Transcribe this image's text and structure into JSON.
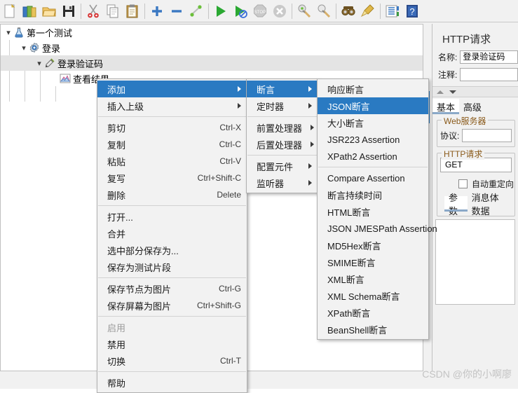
{
  "toolbar": {
    "items": [
      {
        "name": "new-icon",
        "title": "New"
      },
      {
        "name": "templates-icon",
        "title": "Templates"
      },
      {
        "name": "open-icon",
        "title": "Open"
      },
      {
        "name": "save-icon",
        "title": "Save"
      },
      {
        "name": "separator",
        "title": ""
      },
      {
        "name": "cut-icon",
        "title": "Cut"
      },
      {
        "name": "copy-icon",
        "title": "Copy"
      },
      {
        "name": "paste-icon",
        "title": "Paste"
      },
      {
        "name": "separator",
        "title": ""
      },
      {
        "name": "expand-all-icon",
        "title": "Expand All"
      },
      {
        "name": "collapse-all-icon",
        "title": "Collapse All"
      },
      {
        "name": "toggle-icon",
        "title": "Toggle"
      },
      {
        "name": "separator",
        "title": ""
      },
      {
        "name": "start-icon",
        "title": "Start"
      },
      {
        "name": "start-no-timers-icon",
        "title": "Start no pauses"
      },
      {
        "name": "stop-icon",
        "title": "Stop"
      },
      {
        "name": "shutdown-icon",
        "title": "Shutdown"
      },
      {
        "name": "separator",
        "title": ""
      },
      {
        "name": "clear-icon",
        "title": "Clear"
      },
      {
        "name": "clear-all-icon",
        "title": "Clear All"
      },
      {
        "name": "separator",
        "title": ""
      },
      {
        "name": "search-icon",
        "title": "Search"
      },
      {
        "name": "reset-search-icon",
        "title": "Reset Search"
      },
      {
        "name": "separator",
        "title": ""
      },
      {
        "name": "function-helper-icon",
        "title": "Function Helper Dialog"
      },
      {
        "name": "help-icon",
        "title": "Help"
      }
    ]
  },
  "tree": {
    "nodes": [
      {
        "label": "第一个测试",
        "icon": "test-plan-icon",
        "depth": 0,
        "toggle": "expanded",
        "selected": false
      },
      {
        "label": "登录",
        "icon": "thread-group-icon",
        "depth": 1,
        "toggle": "expanded",
        "selected": false
      },
      {
        "label": "登录验证码",
        "icon": "http-sampler-icon",
        "depth": 2,
        "toggle": "expanded",
        "selected": true
      },
      {
        "label": "查看结果",
        "icon": "view-results-icon",
        "depth": 3,
        "toggle": "none",
        "selected": false
      }
    ]
  },
  "context_menu": {
    "items": [
      {
        "label": "添加",
        "accel": "",
        "submenu": true,
        "highlighted": true,
        "disabled": false
      },
      {
        "label": "插入上级",
        "accel": "",
        "submenu": true,
        "highlighted": false,
        "disabled": false
      },
      {
        "separator": true
      },
      {
        "label": "剪切",
        "accel": "Ctrl-X",
        "submenu": false,
        "highlighted": false,
        "disabled": false
      },
      {
        "label": "复制",
        "accel": "Ctrl-C",
        "submenu": false,
        "highlighted": false,
        "disabled": false
      },
      {
        "label": "粘贴",
        "accel": "Ctrl-V",
        "submenu": false,
        "highlighted": false,
        "disabled": false
      },
      {
        "label": "复写",
        "accel": "Ctrl+Shift-C",
        "submenu": false,
        "highlighted": false,
        "disabled": false
      },
      {
        "label": "删除",
        "accel": "Delete",
        "submenu": false,
        "highlighted": false,
        "disabled": false
      },
      {
        "separator": true
      },
      {
        "label": "打开...",
        "accel": "",
        "submenu": false,
        "highlighted": false,
        "disabled": false
      },
      {
        "label": "合并",
        "accel": "",
        "submenu": false,
        "highlighted": false,
        "disabled": false
      },
      {
        "label": "选中部分保存为...",
        "accel": "",
        "submenu": false,
        "highlighted": false,
        "disabled": false
      },
      {
        "label": "保存为测试片段",
        "accel": "",
        "submenu": false,
        "highlighted": false,
        "disabled": false
      },
      {
        "separator": true
      },
      {
        "label": "保存节点为图片",
        "accel": "Ctrl-G",
        "submenu": false,
        "highlighted": false,
        "disabled": false
      },
      {
        "label": "保存屏幕为图片",
        "accel": "Ctrl+Shift-G",
        "submenu": false,
        "highlighted": false,
        "disabled": false
      },
      {
        "separator": true
      },
      {
        "label": "启用",
        "accel": "",
        "submenu": false,
        "highlighted": false,
        "disabled": true
      },
      {
        "label": "禁用",
        "accel": "",
        "submenu": false,
        "highlighted": false,
        "disabled": false
      },
      {
        "label": "切换",
        "accel": "Ctrl-T",
        "submenu": false,
        "highlighted": false,
        "disabled": false
      },
      {
        "separator": true
      },
      {
        "label": "帮助",
        "accel": "",
        "submenu": false,
        "highlighted": false,
        "disabled": false
      }
    ]
  },
  "add_menu": {
    "items": [
      {
        "label": "断言",
        "submenu": true,
        "highlighted": true
      },
      {
        "label": "定时器",
        "submenu": true,
        "highlighted": false
      },
      {
        "separator": true
      },
      {
        "label": "前置处理器",
        "submenu": true,
        "highlighted": false
      },
      {
        "label": "后置处理器",
        "submenu": true,
        "highlighted": false
      },
      {
        "separator": true
      },
      {
        "label": "配置元件",
        "submenu": true,
        "highlighted": false
      },
      {
        "label": "监听器",
        "submenu": true,
        "highlighted": false
      }
    ]
  },
  "assertion_menu": {
    "items": [
      {
        "label": "响应断言",
        "highlighted": false
      },
      {
        "label": "JSON断言",
        "highlighted": true
      },
      {
        "label": "大小断言",
        "highlighted": false
      },
      {
        "label": "JSR223 Assertion",
        "highlighted": false
      },
      {
        "label": "XPath2 Assertion",
        "highlighted": false
      },
      {
        "separator": true
      },
      {
        "label": "Compare Assertion",
        "highlighted": false
      },
      {
        "label": "断言持续时间",
        "highlighted": false
      },
      {
        "label": "HTML断言",
        "highlighted": false
      },
      {
        "label": "JSON JMESPath Assertion",
        "highlighted": false
      },
      {
        "label": "MD5Hex断言",
        "highlighted": false
      },
      {
        "label": "SMIME断言",
        "highlighted": false
      },
      {
        "label": "XML断言",
        "highlighted": false
      },
      {
        "label": "XML Schema断言",
        "highlighted": false
      },
      {
        "label": "XPath断言",
        "highlighted": false
      },
      {
        "label": "BeanShell断言",
        "highlighted": false
      }
    ]
  },
  "right_panel": {
    "title": "HTTP请求",
    "name_label": "名称:",
    "name_value": "登录验证码",
    "comment_label": "注释:",
    "comment_value": "",
    "tabs": [
      {
        "label": "基本",
        "active": true
      },
      {
        "label": "高级",
        "active": false
      }
    ],
    "web_server_group": "Web服务器",
    "protocol_label": "协议:",
    "protocol_value": "",
    "http_request_group": "HTTP请求",
    "method_value": "GET",
    "auto_redirect_label": "自动重定向",
    "auto_redirect_checked": false,
    "follow_redirect_checked": true,
    "sub_tabs": [
      {
        "label": "参数",
        "active": true
      },
      {
        "label": "消息体数据",
        "active": false
      }
    ]
  },
  "watermark": "CSDN @你的小啊廖",
  "colors": {
    "menu_highlight": "#2a7ac2",
    "accent": "#2a7ac2",
    "panel_bg": "#f1f1f1",
    "menu_bg": "#f2f2f2",
    "tree_selected": "#e4e4e4"
  }
}
